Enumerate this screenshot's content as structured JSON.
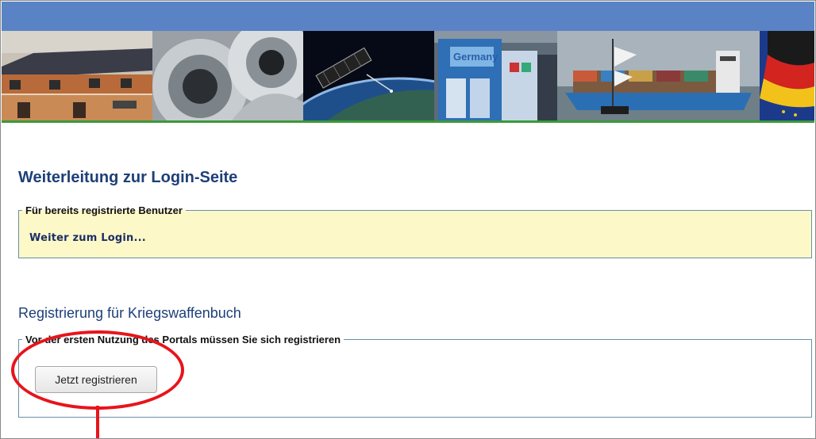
{
  "colors": {
    "top_bar": "#5a83c6",
    "banner_line": "#3a9a3a",
    "heading": "#1e3f78",
    "login_box_bg": "#fcf8c8",
    "highlight_circle": "#e8141b"
  },
  "banner": {
    "panels": [
      "solar-houses-image",
      "steel-coils-image",
      "satellite-image",
      "trade-fair-booth-image",
      "container-ship-image",
      "flags-image"
    ],
    "booth_sign": "Germany"
  },
  "login_section": {
    "title": "Weiterleitung zur Login-Seite",
    "legend": "Für bereits registrierte Benutzer",
    "link_label": "Weiter zum Login..."
  },
  "registration_section": {
    "title": "Registrierung für Kriegswaffenbuch",
    "legend": "Vor der ersten Nutzung des Portals müssen Sie sich registrieren",
    "button_label": "Jetzt registrieren"
  }
}
